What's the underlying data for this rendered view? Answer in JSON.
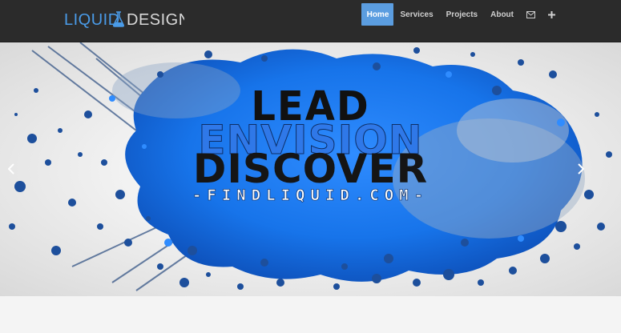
{
  "brand": {
    "left_word": "LIQUID",
    "right_word": "DESIGN"
  },
  "nav": {
    "items": [
      {
        "label": "Home",
        "active": true
      },
      {
        "label": "Services",
        "active": false
      },
      {
        "label": "Projects",
        "active": false
      },
      {
        "label": "About",
        "active": false
      }
    ],
    "icons": [
      "envelope-icon",
      "plus-icon"
    ]
  },
  "hero": {
    "line1": "LEAD",
    "line2": "ENVISION",
    "line3": "DISCOVER",
    "line4": "-FINDLIQUID.COM-"
  },
  "colors": {
    "navbar": "#2b2b2b",
    "accent": "#5b9de0",
    "splash_blue": "#1f7ef0"
  }
}
